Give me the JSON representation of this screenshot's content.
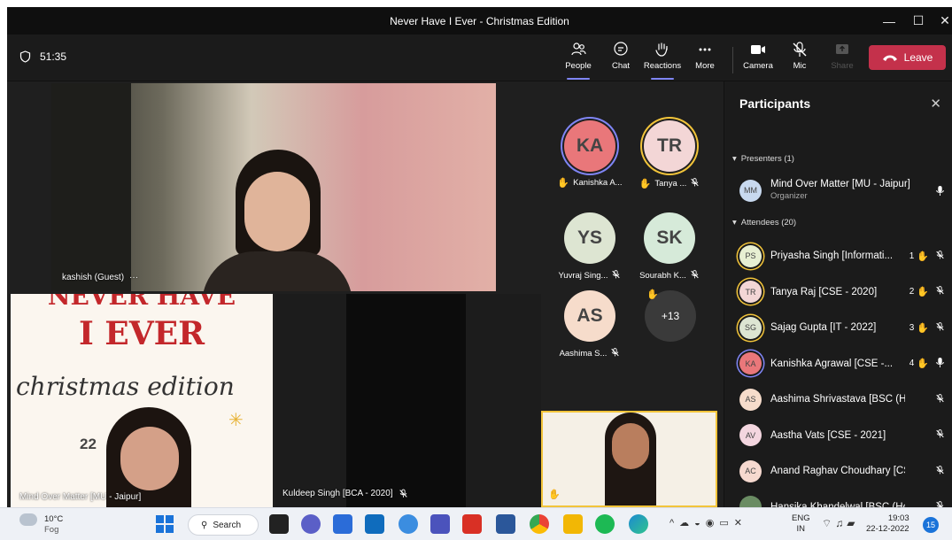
{
  "window": {
    "title": "Never Have I Ever - Christmas Edition",
    "minimize": "—",
    "maximize": "☐",
    "close": "✕"
  },
  "toolbar": {
    "timer": "51:35",
    "people": "People",
    "chat": "Chat",
    "reactions": "Reactions",
    "more": "More",
    "camera": "Camera",
    "mic": "Mic",
    "share": "Share",
    "leave": "Leave"
  },
  "stage": {
    "main_tile_name": "kashish (Guest)",
    "main_tile_more": "···",
    "poster_name": "Mind Over Matter [MU - Jaipur]",
    "poster_line1": "NEVER HAVE",
    "poster_line2": "I EVER",
    "poster_line3": "christmas edition",
    "poster_year": "22",
    "dark_tile_name": "Kuldeep Singh [BCA - 2020]",
    "overflow": "+13",
    "avatars": [
      {
        "initials": "KA",
        "name": "Kanishka A...",
        "color": "#e9777a",
        "ring": "#7f85f5",
        "hand": true,
        "muted": false
      },
      {
        "initials": "TR",
        "name": "Tanya ...",
        "color": "#f3d6d6",
        "ring": "#f2c43a",
        "hand": true,
        "muted": true
      },
      {
        "initials": "YS",
        "name": "Yuvraj Sing...",
        "color": "#dde5d2",
        "ring": "",
        "hand": false,
        "muted": true
      },
      {
        "initials": "SK",
        "name": "Sourabh K...",
        "color": "#d6ead9",
        "ring": "",
        "hand": false,
        "muted": true
      },
      {
        "initials": "AS",
        "name": "Aashima S...",
        "color": "#f6dccb",
        "ring": "",
        "hand": false,
        "muted": true
      }
    ]
  },
  "participants": {
    "title": "Participants",
    "presenters_label": "Presenters (1)",
    "attendees_label": "Attendees (20)",
    "presenter": {
      "initials": "MM",
      "name": "Mind Over Matter [MU - Jaipur]",
      "role": "Organizer",
      "color": "#c8d9ef"
    },
    "attendees": [
      {
        "initials": "PS",
        "name": "Priyasha Singh [Informati...",
        "queue": "1",
        "hand": true,
        "color": "#e7efd2",
        "ring": "#f2c43a",
        "mic": "muted"
      },
      {
        "initials": "TR",
        "name": "Tanya Raj [CSE - 2020]",
        "queue": "2",
        "hand": true,
        "color": "#f3d6d6",
        "ring": "#f2c43a",
        "mic": "muted"
      },
      {
        "initials": "SG",
        "name": "Sajag Gupta [IT - 2022]",
        "queue": "3",
        "hand": true,
        "color": "#dde5d2",
        "ring": "#f2c43a",
        "mic": "muted"
      },
      {
        "initials": "KA",
        "name": "Kanishka Agrawal [CSE -...",
        "queue": "4",
        "hand": true,
        "color": "#e9777a",
        "ring": "#7f85f5",
        "mic": "on"
      },
      {
        "initials": "AS",
        "name": "Aashima Shrivastava [BSC (Hons ...",
        "queue": "",
        "hand": false,
        "color": "#f6dccb",
        "ring": "",
        "mic": "muted"
      },
      {
        "initials": "AV",
        "name": "Aastha Vats [CSE - 2021]",
        "queue": "",
        "hand": false,
        "color": "#f3d6df",
        "ring": "",
        "mic": "muted"
      },
      {
        "initials": "AC",
        "name": "Anand Raghav Choudhary [CSE -...",
        "queue": "",
        "hand": false,
        "color": "#f6d9cf",
        "ring": "",
        "mic": "muted"
      },
      {
        "initials": "",
        "name": "Hansika Khandelwal [BSC (Hons ...",
        "queue": "",
        "hand": false,
        "color": "#6a8c63",
        "ring": "",
        "mic": "muted"
      }
    ]
  },
  "taskbar": {
    "temp": "10°C",
    "weather": "Fog",
    "search": "Search",
    "lang1": "ENG",
    "lang2": "IN",
    "time": "19:03",
    "date": "22-12-2022",
    "notifications": "15"
  }
}
